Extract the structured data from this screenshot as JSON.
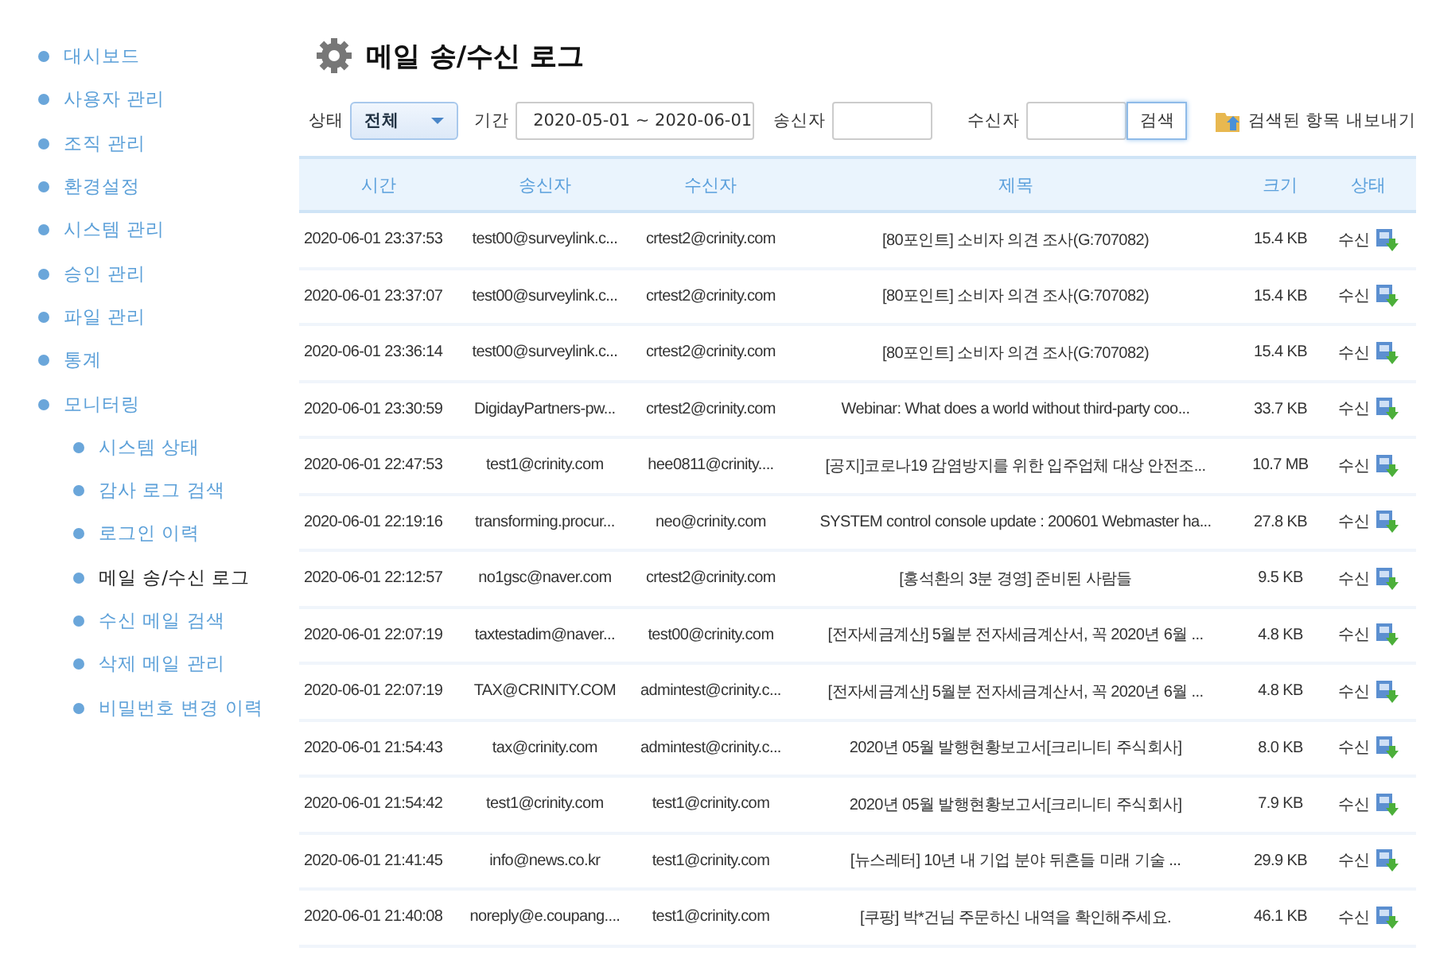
{
  "sidebar": {
    "items": [
      {
        "label": "대시보드",
        "selected": false
      },
      {
        "label": "사용자 관리",
        "selected": false
      },
      {
        "label": "조직 관리",
        "selected": false
      },
      {
        "label": "환경설정",
        "selected": false
      },
      {
        "label": "시스템 관리",
        "selected": false
      },
      {
        "label": "승인 관리",
        "selected": false
      },
      {
        "label": "파일 관리",
        "selected": false
      },
      {
        "label": "통계",
        "selected": false
      },
      {
        "label": "모니터링",
        "selected": false,
        "children": [
          {
            "label": "시스템 상태",
            "selected": false
          },
          {
            "label": "감사 로그 검색",
            "selected": false
          },
          {
            "label": "로그인 이력",
            "selected": false
          },
          {
            "label": "메일 송/수신 로그",
            "selected": true
          },
          {
            "label": "수신 메일 검색",
            "selected": false
          },
          {
            "label": "삭제 메일 관리",
            "selected": false
          },
          {
            "label": "비밀번호 변경 이력",
            "selected": false
          }
        ]
      }
    ]
  },
  "page_title": "메일 송/수신 로그",
  "filters": {
    "status_label": "상태",
    "status_value": "전체",
    "period_label": "기간",
    "period_value": "2020-05-01 ~ 2020-06-01",
    "sender_label": "송신자",
    "receiver_label": "수신자",
    "search_button": "검색",
    "export_link": "검색된 항목 내보내기"
  },
  "table": {
    "columns": [
      "시간",
      "송신자",
      "수신자",
      "제목",
      "크기",
      "상태"
    ],
    "rows": [
      [
        "2020-06-01 23:37:53",
        "test00@surveylink.c...",
        "crtest2@crinity.com",
        "[80포인트] 소비자 의견 조사(G:707082)",
        "15.4 KB",
        "수신"
      ],
      [
        "2020-06-01 23:37:07",
        "test00@surveylink.c...",
        "crtest2@crinity.com",
        "[80포인트] 소비자 의견 조사(G:707082)",
        "15.4 KB",
        "수신"
      ],
      [
        "2020-06-01 23:36:14",
        "test00@surveylink.c...",
        "crtest2@crinity.com",
        "[80포인트] 소비자 의견 조사(G:707082)",
        "15.4 KB",
        "수신"
      ],
      [
        "2020-06-01 23:30:59",
        "DigidayPartners-pw...",
        "crtest2@crinity.com",
        "Webinar: What does a world without third-party coo...",
        "33.7 KB",
        "수신"
      ],
      [
        "2020-06-01 22:47:53",
        "test1@crinity.com",
        "hee0811@crinity....",
        "[공지]코로나19 감염방지를 위한 입주업체 대상 안전조...",
        "10.7 MB",
        "수신"
      ],
      [
        "2020-06-01 22:19:16",
        "transforming.procur...",
        "neo@crinity.com",
        "SYSTEM control console update : 200601 Webmaster ha...",
        "27.8 KB",
        "수신"
      ],
      [
        "2020-06-01 22:12:57",
        "no1gsc@naver.com",
        "crtest2@crinity.com",
        "[홍석환의 3분 경영] 준비된 사람들",
        "9.5 KB",
        "수신"
      ],
      [
        "2020-06-01 22:07:19",
        "taxtestadim@naver...",
        "test00@crinity.com",
        "[전자세금계산] 5월분 전자세금계산서, 꼭 2020년 6월 ...",
        "4.8 KB",
        "수신"
      ],
      [
        "2020-06-01 22:07:19",
        "TAX@CRINITY.COM",
        "admintest@crinity.c...",
        "[전자세금계산] 5월분 전자세금계산서, 꼭 2020년 6월 ...",
        "4.8 KB",
        "수신"
      ],
      [
        "2020-06-01 21:54:43",
        "tax@crinity.com",
        "admintest@crinity.c...",
        "2020년 05월 발행현황보고서[크리니티 주식회사]",
        "8.0 KB",
        "수신"
      ],
      [
        "2020-06-01 21:54:42",
        "test1@crinity.com",
        "test1@crinity.com",
        "2020년 05월 발행현황보고서[크리니티 주식회사]",
        "7.9 KB",
        "수신"
      ],
      [
        "2020-06-01 21:41:45",
        "info@news.co.kr",
        "test1@crinity.com",
        "[뉴스레터] 10년 내 기업 분야 뒤흔들 미래 기술  ...",
        "29.9 KB",
        "수신"
      ],
      [
        "2020-06-01 21:40:08",
        "noreply@e.coupang....",
        "test1@crinity.com",
        "[쿠팡] 박*건님 주문하신 내역을 확인해주세요.",
        "46.1 KB",
        "수신"
      ]
    ]
  }
}
